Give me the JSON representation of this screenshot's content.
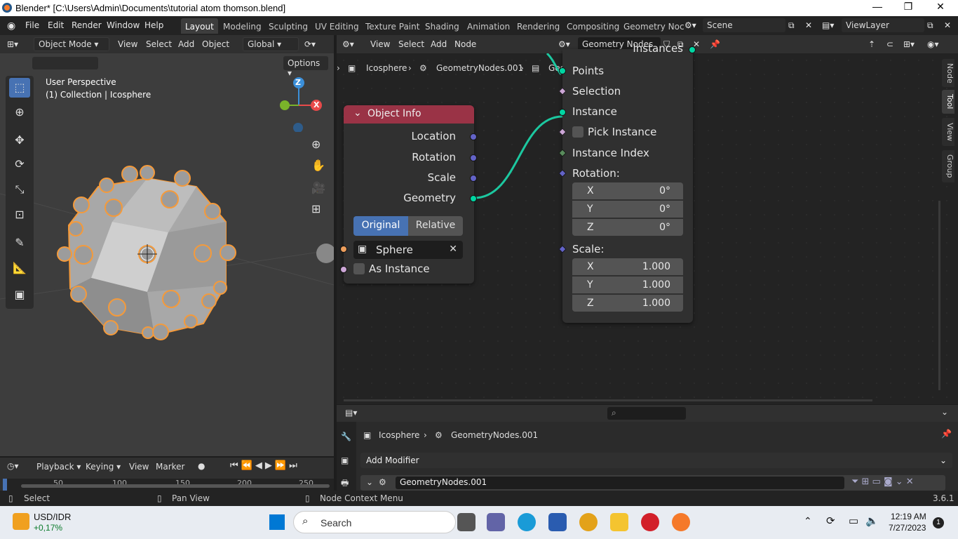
{
  "title_bar": {
    "title": "Blender* [C:\\Users\\Admin\\Documents\\tutorial atom thomson.blend]",
    "minimize": "—",
    "maximize": "❐",
    "close": "✕"
  },
  "top_menu": [
    "File",
    "Edit",
    "Render",
    "Window",
    "Help"
  ],
  "workspace_tabs": [
    "Layout",
    "Modeling",
    "Sculpting",
    "UV Editing",
    "Texture Paint",
    "Shading",
    "Animation",
    "Rendering",
    "Compositing",
    "Geometry Noc"
  ],
  "scene_name": "Scene",
  "view_layer": "ViewLayer",
  "viewport": {
    "mode": "Object Mode",
    "menus": [
      "View",
      "Select",
      "Add",
      "Object"
    ],
    "orientation": "Global",
    "options": "Options",
    "overlay_line1": "User Perspective",
    "overlay_line2": "(1) Collection | Icosphere",
    "gizmo_z": "Z",
    "gizmo_x": "X"
  },
  "node_editor": {
    "menus": [
      "View",
      "Select",
      "Add",
      "Node"
    ],
    "tree_name": "Geometry Nodes",
    "breadcrumb": [
      "Icosphere",
      "GeometryNodes.001",
      "Geometry Nodes"
    ],
    "side_tabs": [
      "Node",
      "Tool",
      "View",
      "Group"
    ],
    "object_info": {
      "title": "Object Info",
      "outputs": [
        "Location",
        "Rotation",
        "Scale",
        "Geometry"
      ],
      "toggle": [
        "Original",
        "Relative"
      ],
      "object": "Sphere",
      "as_instance": "As Instance"
    },
    "instance_node": {
      "top_output": "Instances",
      "inputs": [
        "Points",
        "Selection",
        "Instance",
        "Pick Instance",
        "Instance Index"
      ],
      "rotation_label": "Rotation:",
      "rotation": [
        {
          "axis": "X",
          "value": "0°"
        },
        {
          "axis": "Y",
          "value": "0°"
        },
        {
          "axis": "Z",
          "value": "0°"
        }
      ],
      "scale_label": "Scale:",
      "scale": [
        {
          "axis": "X",
          "value": "1.000"
        },
        {
          "axis": "Y",
          "value": "1.000"
        },
        {
          "axis": "Z",
          "value": "1.000"
        }
      ]
    }
  },
  "properties": {
    "breadcrumb": [
      "Icosphere",
      "GeometryNodes.001"
    ],
    "add_modifier": "Add Modifier",
    "modifier_name": "GeometryNodes.001"
  },
  "timeline": {
    "menus": [
      "Playback",
      "Keying",
      "View",
      "Marker"
    ],
    "ticks": [
      "50",
      "100",
      "150",
      "200",
      "250"
    ]
  },
  "status_bar": {
    "select": "Select",
    "pan": "Pan View",
    "context": "Node Context Menu",
    "version": "3.6.1"
  },
  "taskbar": {
    "stock_name": "USD/IDR",
    "stock_change": "+0,17%",
    "search": "Search",
    "time": "12:19 AM",
    "date": "7/27/2023",
    "notif_count": "1"
  }
}
